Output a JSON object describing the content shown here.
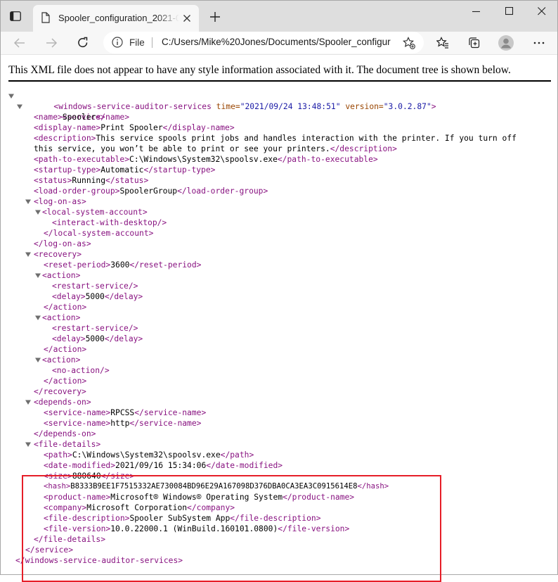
{
  "browser": {
    "tab_title": "Spooler_configuration_2021-09-24",
    "address_scheme": "File",
    "address_url": "C:/Users/Mike%20Jones/Documents/Spooler_configuration_2021-09-24.xml"
  },
  "page": {
    "notice": "This XML file does not appear to have any style information associated with it. The document tree is shown below."
  },
  "xml": {
    "root_open": "<windows-service-auditor-services",
    "root_attr1_name": " time=",
    "root_attr1_value": "\"2021/09/24 13:48:51\"",
    "root_attr2_name": " version=",
    "root_attr2_value": "\"3.0.2.87\"",
    "root_gt": ">",
    "service_open": "<service>",
    "name_open": "<name>",
    "name_value": "Spooler",
    "name_close": "</name>",
    "display_open": "<display-name>",
    "display_value": "Print Spooler",
    "display_close": "</display-name>",
    "desc_open": "<description>",
    "desc_value_1": "This service spools print jobs and handles interaction with the printer. If you turn off",
    "desc_value_2": "this service, you won’t be able to print or see your printers.",
    "desc_close": "</description>",
    "path_exec_open": "<path-to-executable>",
    "path_exec_value": "C:\\Windows\\System32\\spoolsv.exe",
    "path_exec_close": "</path-to-executable>",
    "startup_open": "<startup-type>",
    "startup_value": "Automatic",
    "startup_close": "</startup-type>",
    "status_open": "<status>",
    "status_value": "Running",
    "status_close": "</status>",
    "log_open": "<load-order-group>",
    "log_value": "SpoolerGroup",
    "log_close": "</load-order-group>",
    "logon_open": "<log-on-as>",
    "lsa_open": "<local-system-account>",
    "interact": "<interact-with-desktop/>",
    "lsa_close": "</local-system-account>",
    "logon_close": "</log-on-as>",
    "recovery_open": "<recovery>",
    "reset_open": "<reset-period>",
    "reset_value": "3600",
    "reset_close": "</reset-period>",
    "action_open": "<action>",
    "restart": "<restart-service/>",
    "delay_open": "<delay>",
    "delay_value": "5000",
    "delay_close": "</delay>",
    "action_close": "</action>",
    "no_action": "<no-action/>",
    "recovery_close": "</recovery>",
    "depends_open": "<depends-on>",
    "svcname_open": "<service-name>",
    "svcname_value_1": "RPCSS",
    "svcname_value_2": "http",
    "svcname_close": "</service-name>",
    "depends_close": "</depends-on>",
    "filedetails_open": "<file-details>",
    "fpath_open": "<path>",
    "fpath_value": "C:\\Windows\\System32\\spoolsv.exe",
    "fpath_close": "</path>",
    "datemod_open": "<date-modified>",
    "datemod_value": "2021/09/16 15:34:06",
    "datemod_close": "</date-modified>",
    "size_open": "<size>",
    "size_value": "880640",
    "size_close": "</size>",
    "hash_open": "<hash>",
    "hash_value": "B8333B9EE1F7515332AE730084BD96E29A167098D376DBA0CA3EA3C0915614E8",
    "hash_close": "</hash>",
    "product_open": "<product-name>",
    "product_value": "Microsoft® Windows® Operating System",
    "product_close": "</product-name>",
    "company_open": "<company>",
    "company_value": "Microsoft Corporation",
    "company_close": "</company>",
    "fdesc_open": "<file-description>",
    "fdesc_value": "Spooler SubSystem App",
    "fdesc_close": "</file-description>",
    "fver_open": "<file-version>",
    "fver_value": "10.0.22000.1 (WinBuild.160101.0800)",
    "fver_close": "</file-version>",
    "filedetails_close": "</file-details>",
    "service_close": "</service>",
    "root_close": "</windows-service-auditor-services>"
  },
  "colors": {
    "tag": "#881280",
    "attr_name": "#994500",
    "attr_value": "#1a1aa6",
    "highlight": "#e61e28"
  }
}
